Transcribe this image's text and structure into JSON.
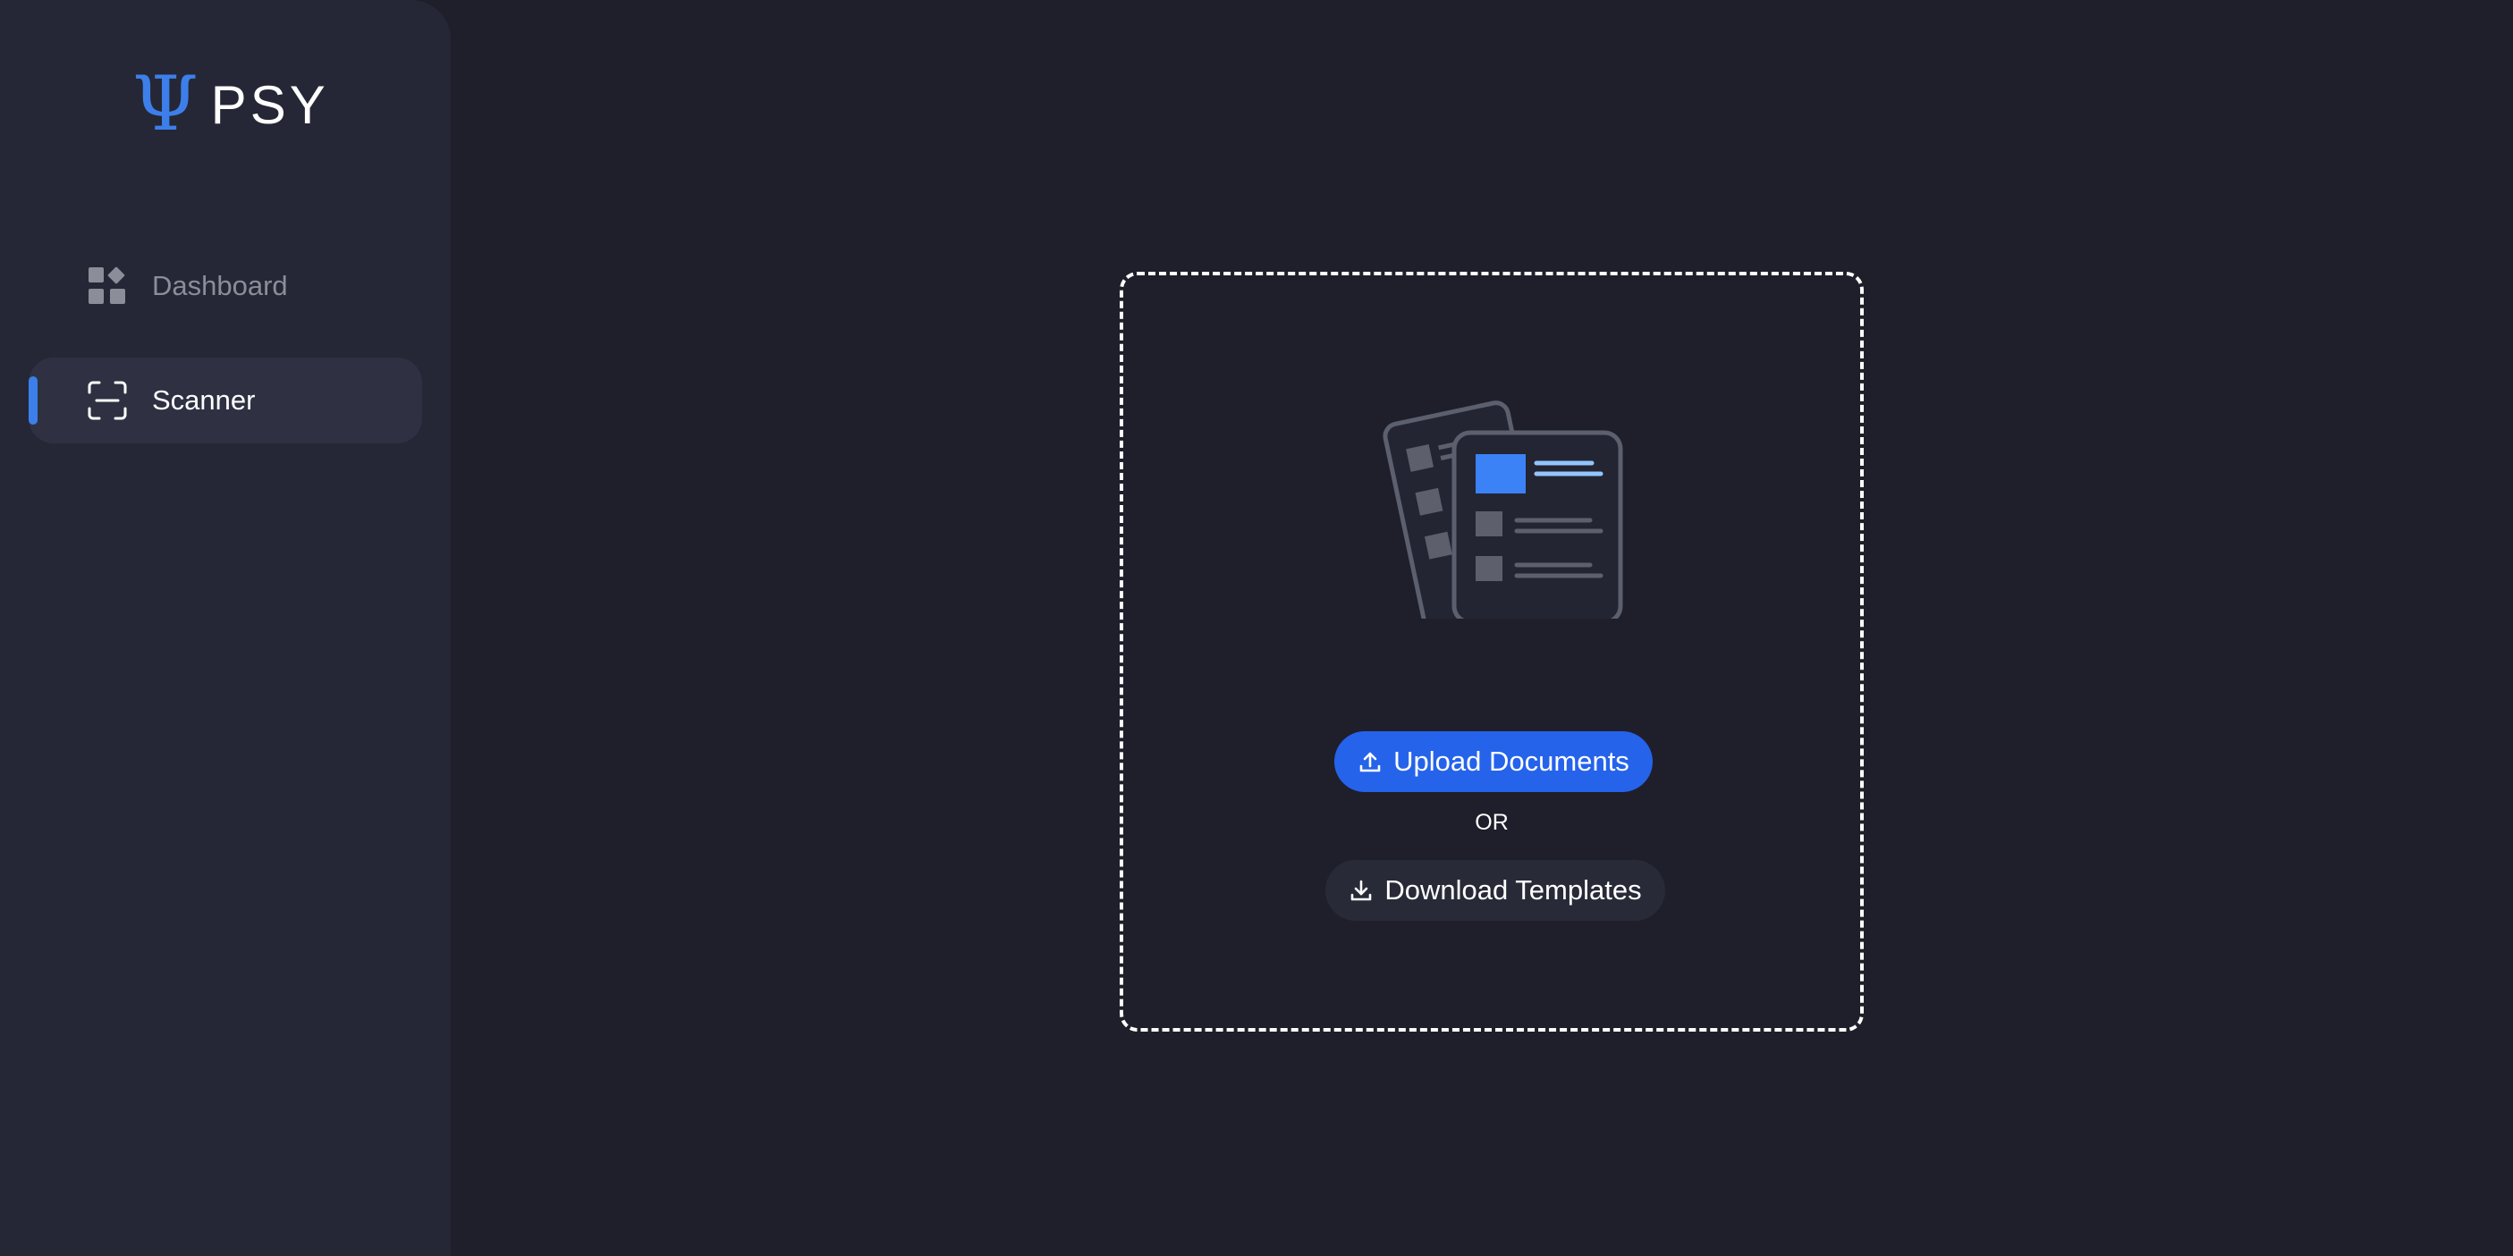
{
  "brand": {
    "mark": "Ψ",
    "name": "PSY",
    "accent_color": "#3d7fea"
  },
  "sidebar": {
    "items": [
      {
        "label": "Dashboard",
        "icon": "dashboard-grid-icon",
        "active": false
      },
      {
        "label": "Scanner",
        "icon": "scan-icon",
        "active": true
      }
    ]
  },
  "main": {
    "dropzone": {
      "illustration": "documents-icon",
      "upload_label": "Upload Documents",
      "upload_icon": "upload-icon",
      "or_label": "OR",
      "download_label": "Download Templates",
      "download_icon": "download-icon"
    }
  },
  "colors": {
    "background": "#1f1f2b",
    "sidebar": "#252736",
    "primary_button": "#2563eb",
    "secondary_button": "#282a38"
  }
}
